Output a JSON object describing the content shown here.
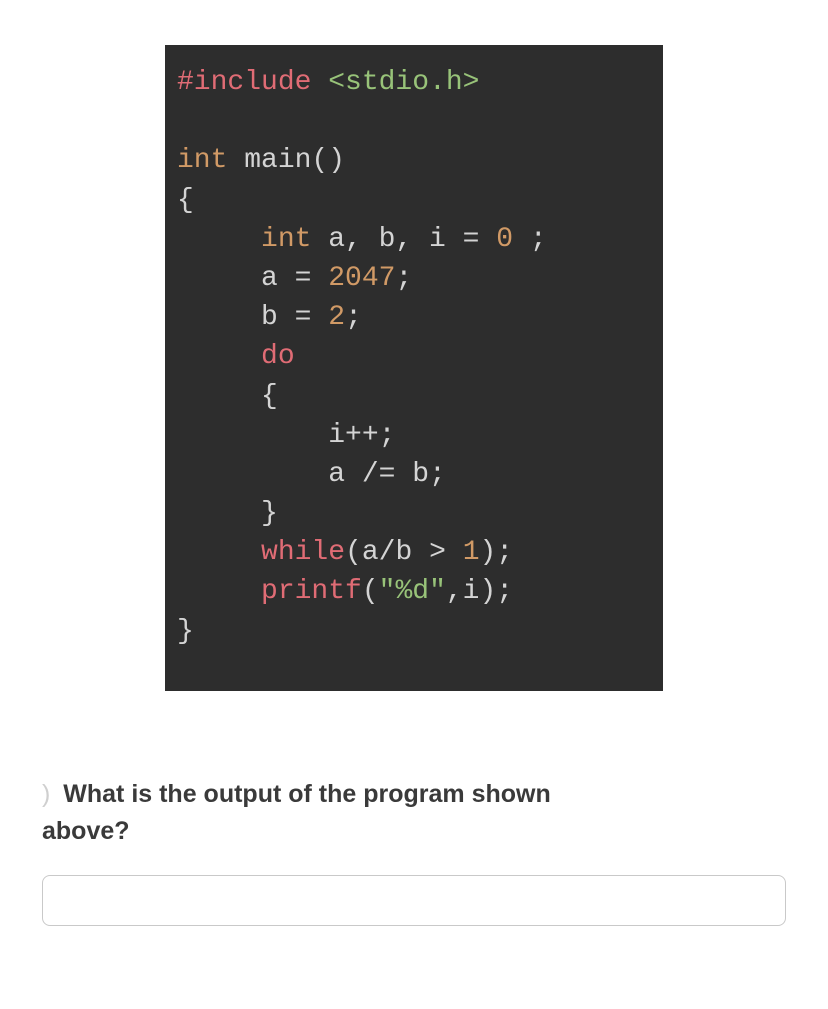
{
  "code": {
    "line1_include": "#include",
    "line1_header": " <stdio.h>",
    "line3_type": "int",
    "line3_main": " main()",
    "line4_brace": "{",
    "line5_indent": "     ",
    "line5_type": "int",
    "line5_vars": " a, b, i ",
    "line5_eq": "=",
    "line5_sp": " ",
    "line5_zero": "0",
    "line5_end": " ;",
    "line6_indent": "     a ",
    "line6_eq": "=",
    "line6_sp": " ",
    "line6_num": "2047",
    "line6_end": ";",
    "line7_indent": "     b ",
    "line7_eq": "=",
    "line7_sp": " ",
    "line7_num": "2",
    "line7_end": ";",
    "line8_indent": "     ",
    "line8_do": "do",
    "line9_indent": "     {",
    "line10_indent": "         i",
    "line10_op": "++",
    "line10_end": ";",
    "line11_indent": "         a ",
    "line11_op": "/=",
    "line11_rest": " b;",
    "line12_indent": "     }",
    "line13_indent": "     ",
    "line13_while": "while",
    "line13_open": "(a",
    "line13_div": "/",
    "line13_b": "b ",
    "line13_gt": ">",
    "line13_sp": " ",
    "line13_one": "1",
    "line13_close": ");",
    "line14_indent": "     ",
    "line14_printf": "printf",
    "line14_open": "(",
    "line14_str": "\"%d\"",
    "line14_rest": ",i);",
    "line15_brace": "}"
  },
  "question": {
    "prefix": "      ",
    "paren": ")",
    "text_part1": " What is the output of the program shown ",
    "text_part2": "above?"
  },
  "answer": {
    "placeholder": ""
  }
}
